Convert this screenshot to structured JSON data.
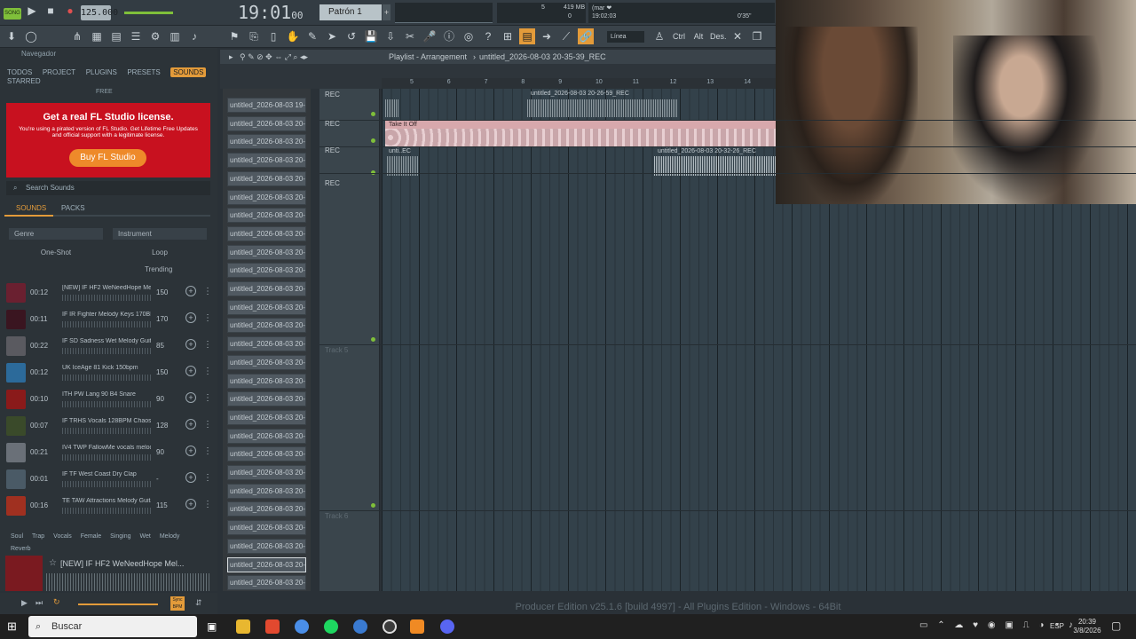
{
  "toolbar": {
    "song_mode": "SONG",
    "tempo": "125.000",
    "time": "19:01",
    "time_sub": "00",
    "pattern": "Patrón 1",
    "cpu": "5",
    "memory": "419 MB",
    "mem2": "0",
    "hint_title": "(mar ❤",
    "hint_time": "19:02:03",
    "hint_right": "0'35\"",
    "line_mode": "Línea",
    "ctrl": "Ctrl",
    "alt": "Alt",
    "des": "Des."
  },
  "browser": {
    "header": "Navegador",
    "tabs": [
      "TODOS",
      "PROJECT",
      "PLUGINS",
      "PRESETS",
      "SOUNDS",
      "STARRED"
    ],
    "free_label": "FREE",
    "ad_title": "Get a real FL Studio license.",
    "ad_text": "You're using a pirated version of FL Studio. Get Lifetime Free Updates and official support with a legitimate license.",
    "ad_button": "Buy FL Studio",
    "search_placeholder": "Search Sounds",
    "subtabs": [
      "SOUNDS",
      "PACKS"
    ],
    "filter_genre": "Genre",
    "filter_instrument": "Instrument",
    "type_oneshot": "One-Shot",
    "type_loop": "Loop",
    "sort": "Trending",
    "sounds": [
      {
        "dur": "00:12",
        "name": "[NEW] IF HF2 WeNeedHope Mel...",
        "bpm": "150",
        "color": "#6a2030"
      },
      {
        "dur": "00:11",
        "name": "IF IR Fighter Melody Keys 170BPM...",
        "bpm": "170",
        "color": "#3a1520"
      },
      {
        "dur": "00:22",
        "name": "IF SD Sadness Wet Melody Guitar...",
        "bpm": "85",
        "color": "#5a5a60"
      },
      {
        "dur": "00:12",
        "name": "UK IceAge 81 Kick 150bpm",
        "bpm": "150",
        "color": "#2c6a9a"
      },
      {
        "dur": "00:10",
        "name": "ITH PW Lang 90 B4 Snare",
        "bpm": "90",
        "color": "#8a1a1a"
      },
      {
        "dur": "00:07",
        "name": "IF TRHS Vocals 128BPM Chaos",
        "bpm": "128",
        "color": "#3a4a2a"
      },
      {
        "dur": "00:21",
        "name": "IV4 TWP FallowMe vocals melody...",
        "bpm": "90",
        "color": "#6a7078"
      },
      {
        "dur": "00:01",
        "name": "IF TF West Coast Dry Clap",
        "bpm": "-",
        "color": "#4a5a66"
      },
      {
        "dur": "00:16",
        "name": "TE TAW Attractions Melody Guitar...",
        "bpm": "115",
        "color": "#a03020"
      }
    ],
    "tags": [
      "Soul",
      "Trap",
      "Vocals",
      "Female",
      "Singing",
      "Wet",
      "Melody",
      "Reverb"
    ],
    "preview_name": "[NEW] IF HF2 WeNeedHope Mel...",
    "sync_label": "Sync BPM"
  },
  "playlist": {
    "title": "Playlist - Arrangement",
    "project": "untitled_2026-08-03 20-35-39_REC",
    "ruler": [
      "5",
      "6",
      "7",
      "8",
      "9",
      "10",
      "11",
      "12",
      "13",
      "14"
    ],
    "patterns": [
      "untitled_2026-08-03 19-...",
      "untitled_2026-08-03 20-...",
      "untitled_2026-08-03 20-...",
      "untitled_2026-08-03 20-...",
      "untitled_2026-08-03 20-...",
      "untitled_2026-08-03 20-...",
      "untitled_2026-08-03 20-...",
      "untitled_2026-08-03 20-...",
      "untitled_2026-08-03 20-...",
      "untitled_2026-08-03 20-...",
      "untitled_2026-08-03 20-...",
      "untitled_2026-08-03 20-...",
      "untitled_2026-08-03 20-...",
      "untitled_2026-08-03 20-...",
      "untitled_2026-08-03 20-...",
      "untitled_2026-08-03 20-...",
      "untitled_2026-08-03 20-...",
      "untitled_2026-08-03 20-...",
      "untitled_2026-08-03 20-...",
      "untitled_2026-08-03 20-...",
      "untitled_2026-08-03 20-...",
      "untitled_2026-08-03 20-...",
      "untitled_2026-08-03 20-...",
      "untitled_2026-08-03 20-...",
      "untitled_2026-08-03 20-...",
      "untitled_2026-08-03 20-...",
      "untitled_2026-08-03 20-..."
    ],
    "tracks": [
      "REC",
      "REC",
      "REC",
      "REC",
      "Track 5",
      "Track 6"
    ],
    "clips": [
      "untitled_2026-08-03 20-26-59_REC",
      "Take It Off",
      "unti..EC",
      "untitled_2026-08-03 20-32-26_REC"
    ]
  },
  "status_text": "Producer Edition v25.1.6 [build 4997] - All Plugins Edition - Windows - 64Bit",
  "taskbar": {
    "search": "Buscar",
    "lang": "ESP",
    "time": "20:39",
    "date": "3/8/2026"
  }
}
